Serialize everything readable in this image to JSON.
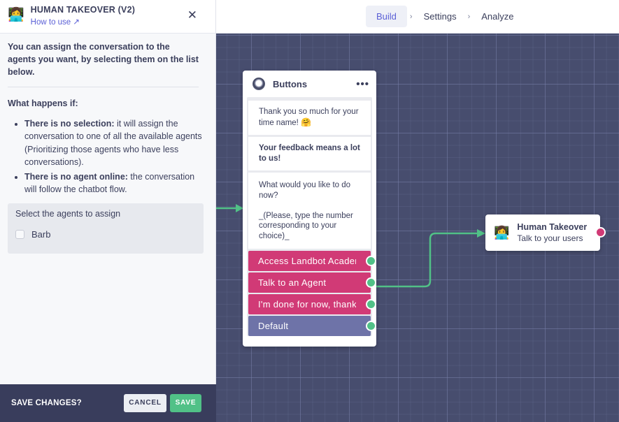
{
  "nav": {
    "steps": [
      {
        "label": "Build",
        "active": true
      },
      {
        "label": "Settings",
        "active": false
      },
      {
        "label": "Analyze",
        "active": false
      }
    ],
    "separator": "›"
  },
  "panel": {
    "title": "HUMAN TAKEOVER (V2)",
    "how_to_use": "How to use",
    "how_to_use_icon": "↗",
    "close_icon": "✕",
    "intro": "You can assign the conversation to the agents you want, by selecting them on the list below.",
    "what_happens_title": "What happens if:",
    "bullets": [
      {
        "bold": "There is no selection:",
        "text": " it will assign the conversation to one of all the available agents (Prioritizing those agents who have less conversations)."
      },
      {
        "bold": "There is no agent online:",
        "text": " the conversation will follow the chatbot flow."
      }
    ],
    "agents_title": "Select the agents to assign",
    "agents": [
      {
        "name": "Barb",
        "checked": false
      }
    ]
  },
  "footer": {
    "label": "SAVE CHANGES?",
    "cancel": "CANCEL",
    "save": "SAVE"
  },
  "buttons_node": {
    "title": "Buttons",
    "menu_icon": "•••",
    "messages": [
      {
        "text": "Thank you so much for your time name! ",
        "emoji": "🤗",
        "bold": false
      },
      {
        "text": "Your feedback means a lot to us!",
        "bold": true
      },
      {
        "text": "What would you like to do now?\n\n_(Please, type the number corresponding to your choice)_",
        "bold": false
      }
    ],
    "options": [
      {
        "label": "Access Landbot Academy",
        "type": "button"
      },
      {
        "label": "Talk to an Agent",
        "type": "button"
      },
      {
        "label": "I'm done for now, thanks",
        "type": "button"
      },
      {
        "label": "Default",
        "type": "default"
      }
    ]
  },
  "human_takeover_node": {
    "icon": "👩‍💻",
    "title": "Human Takeover",
    "subtitle": "Talk to your users"
  },
  "colors": {
    "accent": "#5a5fd6",
    "button_option": "#d13a76",
    "default_option": "#6e73a8",
    "connector": "#51c187",
    "canvas": "#474d6e",
    "footer": "#393d5c"
  }
}
